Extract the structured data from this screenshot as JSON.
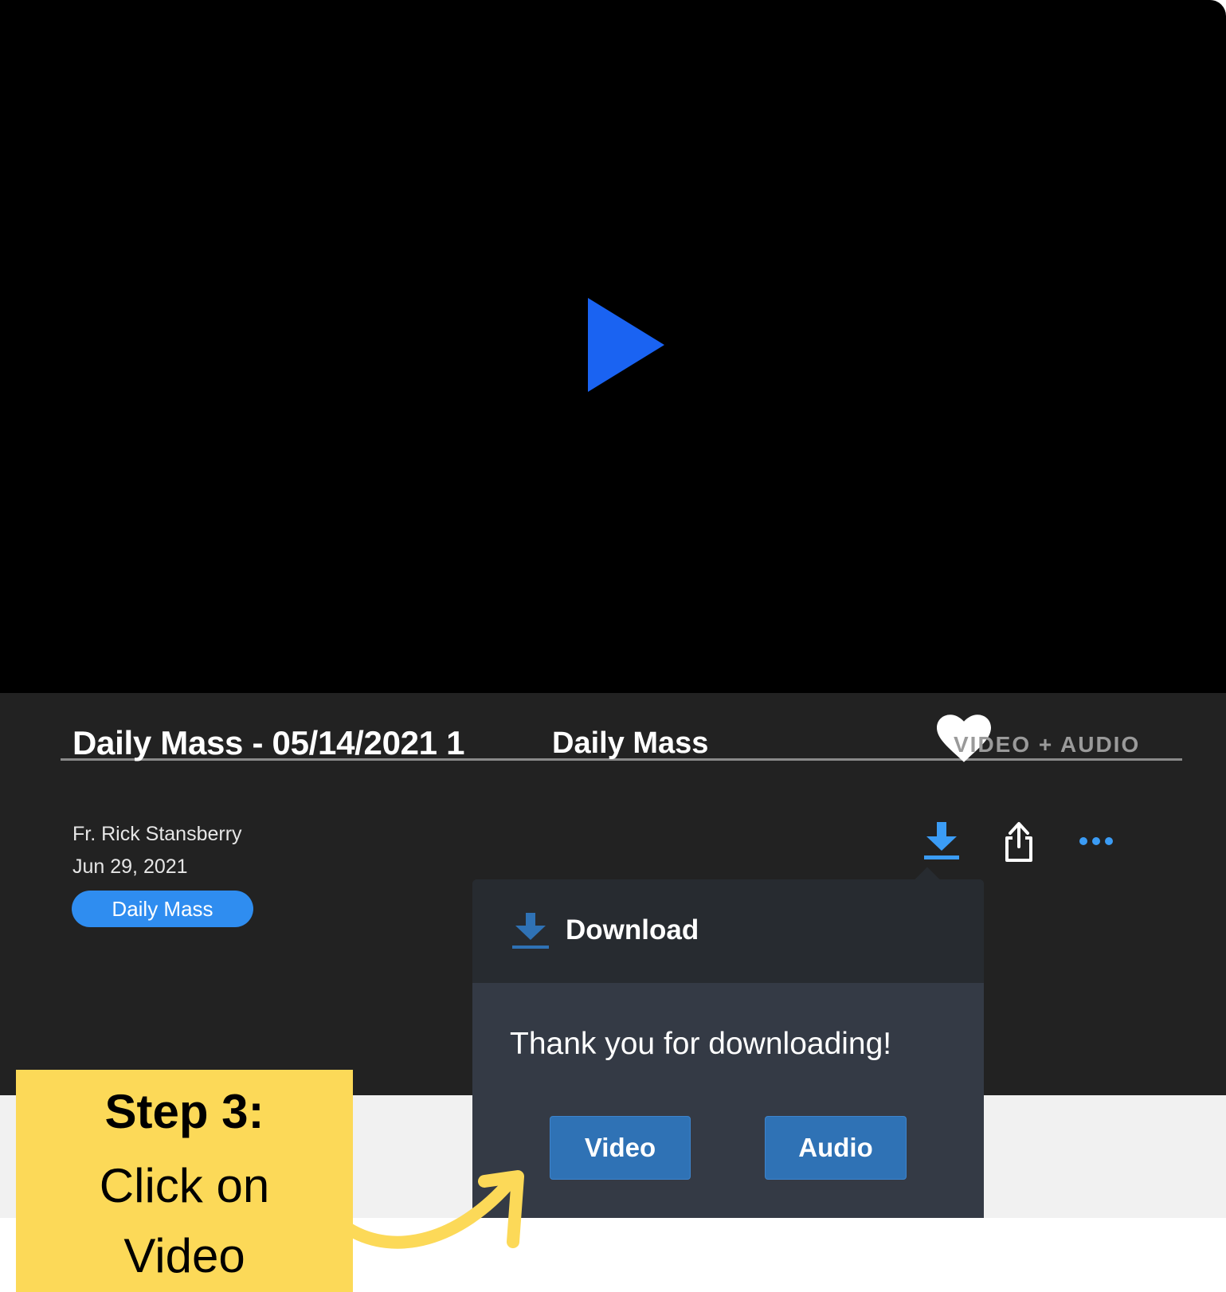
{
  "player": {
    "play_icon": "play-icon",
    "play_color": "#1a63f2"
  },
  "media": {
    "title": "Daily Mass - 05/14/2021 1",
    "series": "Daily Mass",
    "favorite_icon": "heart-icon",
    "type_label": "VIDEO + AUDIO",
    "speaker": "Fr. Rick Stansberry",
    "date": "Jun 29, 2021",
    "tag": "Daily Mass"
  },
  "actions": {
    "download_icon": "download-icon",
    "share_icon": "share-icon",
    "more_icon": "more-icon"
  },
  "download_popover": {
    "title": "Download",
    "message": "Thank you for downloading!",
    "video_button": "Video",
    "audio_button": "Audio"
  },
  "callout": {
    "step": "Step 3:",
    "instruction": "Click on Video"
  },
  "colors": {
    "accent_blue": "#2f8df0",
    "button_blue": "#2f72b5",
    "callout_yellow": "#fcd958",
    "panel_dark": "#222222"
  }
}
